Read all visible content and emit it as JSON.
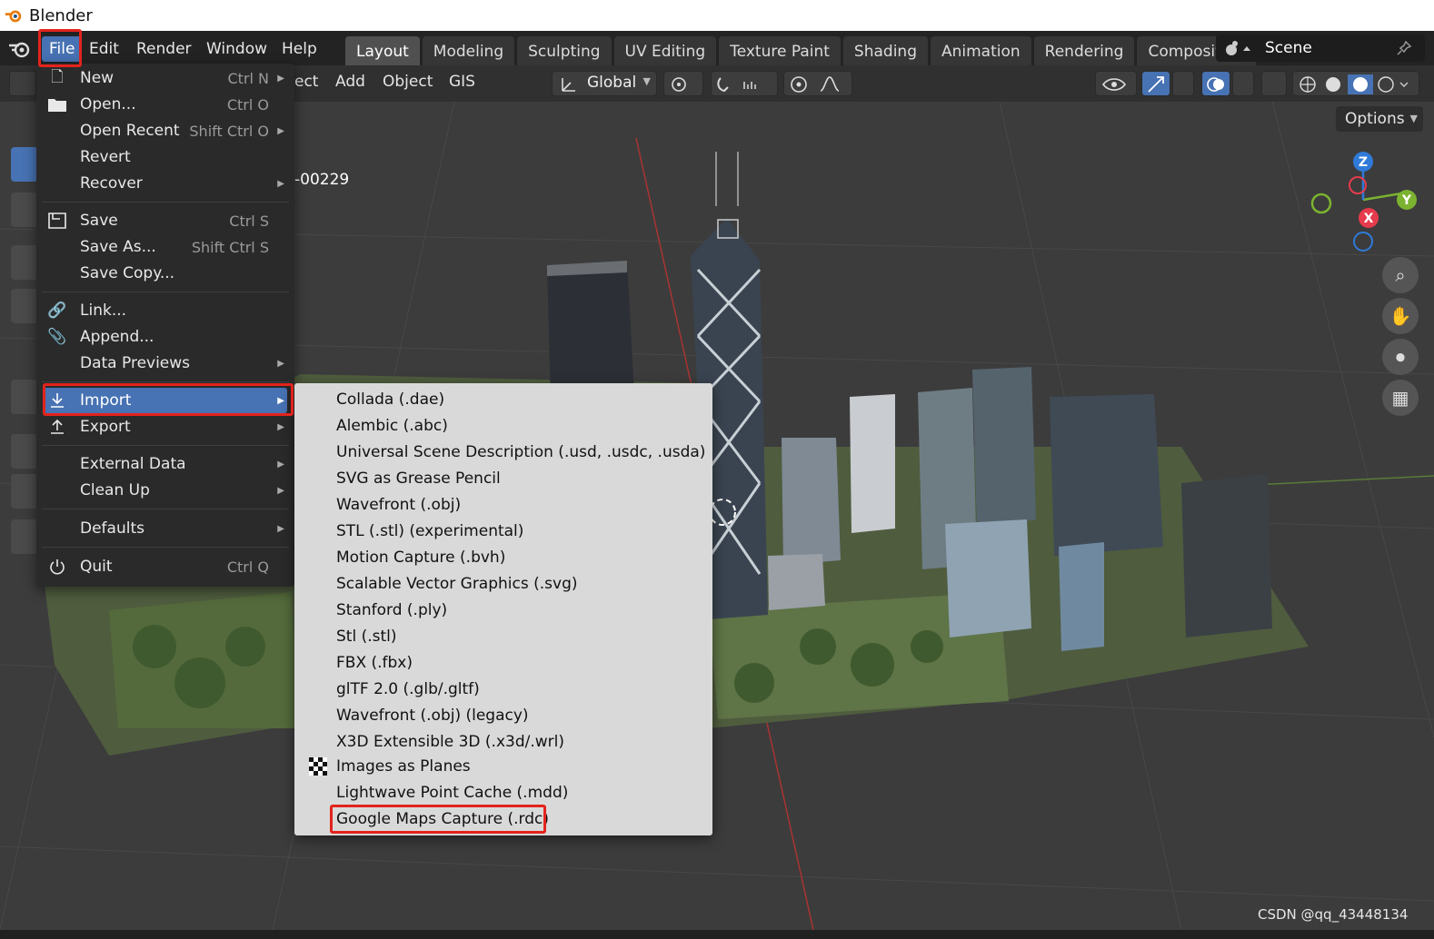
{
  "window": {
    "title": "Blender"
  },
  "topbar": {
    "menus": [
      "File",
      "Edit",
      "Render",
      "Window",
      "Help"
    ],
    "workspace_tabs": [
      "Layout",
      "Modeling",
      "Sculpting",
      "UV Editing",
      "Texture Paint",
      "Shading",
      "Animation",
      "Rendering",
      "Compositing"
    ],
    "active_tab": "Layout",
    "scene_name": "Scene"
  },
  "viewport_header": {
    "menus": [
      "ect",
      "Add",
      "Object",
      "GIS"
    ],
    "transform_orientation": "Global",
    "options_label": "Options"
  },
  "viewport": {
    "frame_label": "-00229",
    "gizmo_axes": {
      "z": "Z",
      "y": "Y",
      "x": "X"
    }
  },
  "file_menu": {
    "items": [
      {
        "label": "New",
        "shortcut": "Ctrl N",
        "icon": "new-file-icon",
        "submenu": true
      },
      {
        "label": "Open...",
        "shortcut": "Ctrl O",
        "icon": "folder-icon"
      },
      {
        "label": "Open Recent",
        "shortcut": "Shift Ctrl O",
        "icon": "",
        "submenu": true
      },
      {
        "label": "Revert",
        "shortcut": "",
        "icon": ""
      },
      {
        "label": "Recover",
        "shortcut": "",
        "icon": "",
        "submenu": true
      },
      {
        "label": "Save",
        "shortcut": "Ctrl S",
        "icon": "save-icon"
      },
      {
        "label": "Save As...",
        "shortcut": "Shift Ctrl S",
        "icon": ""
      },
      {
        "label": "Save Copy...",
        "shortcut": "",
        "icon": ""
      },
      {
        "label": "Link...",
        "shortcut": "",
        "icon": "link-icon"
      },
      {
        "label": "Append...",
        "shortcut": "",
        "icon": "paperclip-icon"
      },
      {
        "label": "Data Previews",
        "shortcut": "",
        "icon": "",
        "submenu": true
      },
      {
        "label": "Import",
        "shortcut": "",
        "icon": "import-icon",
        "submenu": true,
        "highlighted": true
      },
      {
        "label": "Export",
        "shortcut": "",
        "icon": "export-icon",
        "submenu": true
      },
      {
        "label": "External Data",
        "shortcut": "",
        "icon": "",
        "submenu": true
      },
      {
        "label": "Clean Up",
        "shortcut": "",
        "icon": "",
        "submenu": true
      },
      {
        "label": "Defaults",
        "shortcut": "",
        "icon": "",
        "submenu": true
      },
      {
        "label": "Quit",
        "shortcut": "Ctrl Q",
        "icon": "power-icon"
      }
    ]
  },
  "import_menu": {
    "items": [
      "Collada (.dae)",
      "Alembic (.abc)",
      "Universal Scene Description (.usd, .usdc, .usda)",
      "SVG as Grease Pencil",
      "Wavefront (.obj)",
      "STL (.stl) (experimental)",
      "Motion Capture (.bvh)",
      "Scalable Vector Graphics (.svg)",
      "Stanford (.ply)",
      "Stl (.stl)",
      "FBX (.fbx)",
      "glTF 2.0 (.glb/.gltf)",
      "Wavefront (.obj) (legacy)",
      "X3D Extensible 3D (.x3d/.wrl)",
      "Images as Planes",
      "Lightwave Point Cache (.mdd)",
      "Google Maps Capture (.rdc)"
    ]
  },
  "watermark": "CSDN @qq_43448134"
}
